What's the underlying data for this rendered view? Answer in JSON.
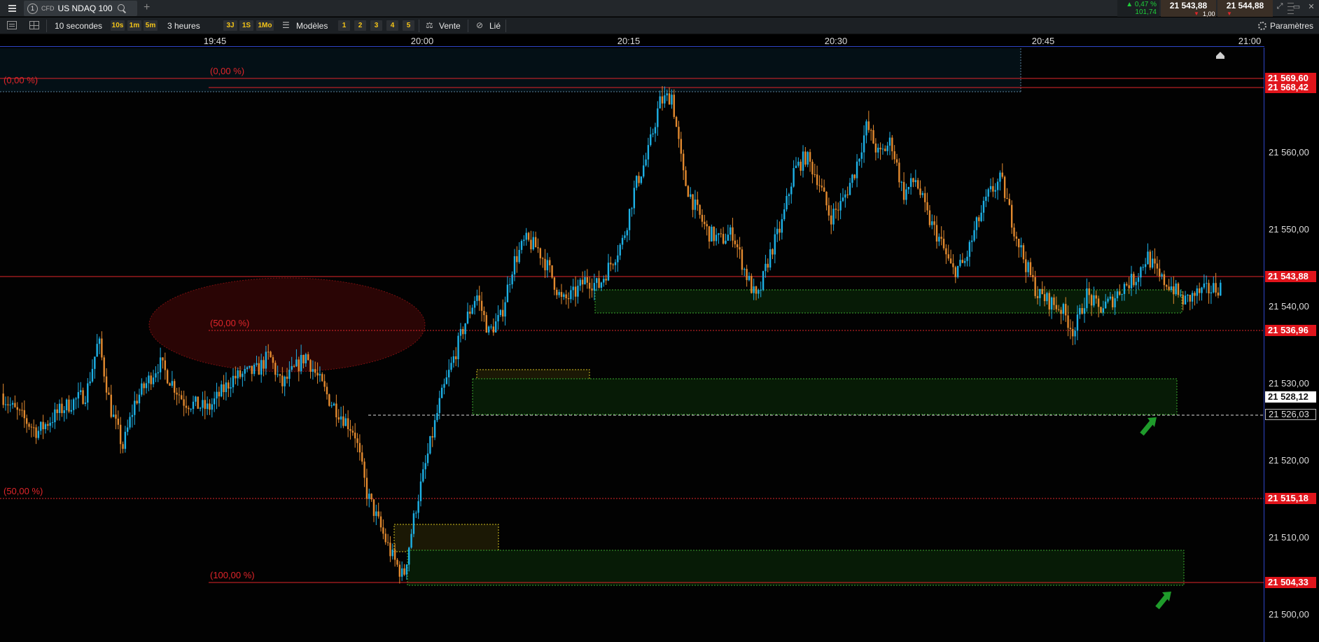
{
  "window": {
    "tab_number": "1",
    "tab_type": "CFD",
    "instrument": "US NDAQ 100",
    "change_pct": "▲ 0,47 %",
    "change_abs": "101,74",
    "bid_price": "21 543,88",
    "ask_price": "21 544,88",
    "spread": "1,00"
  },
  "toolbar": {
    "interval": "10 secondes",
    "interval_buttons": [
      "10s",
      "1m",
      "5m"
    ],
    "period": "3 heures",
    "period_buttons": [
      "3J",
      "1S",
      "1Mo"
    ],
    "models_label": "Modèles",
    "layout_buttons": [
      "1",
      "2",
      "3",
      "4",
      "5"
    ],
    "side_label": "Vente",
    "link_label": "Lié",
    "settings_label": "Paramètres"
  },
  "time_axis": [
    "19:45",
    "20:00",
    "20:15",
    "20:30",
    "20:45",
    "21:00"
  ],
  "price_axis": {
    "ticks": [
      "21 560,00",
      "21 550,00",
      "21 540,00",
      "21 530,00",
      "21 520,00",
      "21 510,00",
      "21 500,00"
    ],
    "tags": {
      "top1": "21 569,60",
      "top2": "21 568,42",
      "current": "21 543,88",
      "fib50_upper": "21 536,96",
      "crosshair": "21 528,12",
      "dashed": "21 526,03",
      "fib50_lower": "21 515,18",
      "bottom": "21 504,33"
    }
  },
  "fib_labels": {
    "upper_0": "(0,00 %)",
    "lower_0": "(0,00 %)",
    "upper_50": "(50,00 %)",
    "lower_50": "(50,00 %)",
    "lower_100": "(100,00 %)"
  },
  "colors": {
    "up_candle": "#1db1e6",
    "down_candle": "#e38a2f",
    "fib_line": "#e0252a",
    "zone_green": "#3ba82d",
    "zone_yellow": "#d6c21e",
    "axis_blue": "#2e46c8",
    "arrow_green": "#1f9b2b"
  },
  "chart_data": {
    "type": "candlestick",
    "instrument": "US NDAQ 100",
    "interval": "10 secondes",
    "time_range": [
      "19:40",
      "21:00"
    ],
    "ylim": [
      21497,
      21570
    ],
    "price_path": [
      [
        0,
        21529
      ],
      [
        0.01,
        21527
      ],
      [
        0.03,
        21524
      ],
      [
        0.05,
        21527
      ],
      [
        0.07,
        21529
      ],
      [
        0.08,
        21536
      ],
      [
        0.09,
        21527
      ],
      [
        0.1,
        21522
      ],
      [
        0.11,
        21528
      ],
      [
        0.13,
        21533
      ],
      [
        0.15,
        21528
      ],
      [
        0.17,
        21527
      ],
      [
        0.19,
        21531
      ],
      [
        0.21,
        21532
      ],
      [
        0.22,
        21534
      ],
      [
        0.23,
        21530
      ],
      [
        0.25,
        21534
      ],
      [
        0.27,
        21528
      ],
      [
        0.29,
        21524
      ],
      [
        0.3,
        21516
      ],
      [
        0.31,
        21512
      ],
      [
        0.32,
        21508
      ],
      [
        0.33,
        21505
      ],
      [
        0.34,
        21514
      ],
      [
        0.35,
        21521
      ],
      [
        0.36,
        21528
      ],
      [
        0.37,
        21533
      ],
      [
        0.38,
        21538
      ],
      [
        0.39,
        21542
      ],
      [
        0.4,
        21537
      ],
      [
        0.41,
        21539
      ],
      [
        0.42,
        21546
      ],
      [
        0.43,
        21549
      ],
      [
        0.44,
        21548
      ],
      [
        0.45,
        21545
      ],
      [
        0.46,
        21541
      ],
      [
        0.47,
        21542
      ],
      [
        0.48,
        21544
      ],
      [
        0.49,
        21543
      ],
      [
        0.5,
        21546
      ],
      [
        0.51,
        21549
      ],
      [
        0.52,
        21556
      ],
      [
        0.53,
        21560
      ],
      [
        0.54,
        21567
      ],
      [
        0.55,
        21568
      ],
      [
        0.56,
        21557
      ],
      [
        0.57,
        21553
      ],
      [
        0.58,
        21550
      ],
      [
        0.59,
        21549
      ],
      [
        0.6,
        21550
      ],
      [
        0.61,
        21545
      ],
      [
        0.62,
        21541
      ],
      [
        0.63,
        21547
      ],
      [
        0.64,
        21551
      ],
      [
        0.65,
        21558
      ],
      [
        0.66,
        21560
      ],
      [
        0.67,
        21557
      ],
      [
        0.68,
        21552
      ],
      [
        0.69,
        21554
      ],
      [
        0.7,
        21558
      ],
      [
        0.71,
        21564
      ],
      [
        0.72,
        21560
      ],
      [
        0.73,
        21562
      ],
      [
        0.74,
        21555
      ],
      [
        0.75,
        21557
      ],
      [
        0.76,
        21552
      ],
      [
        0.77,
        21549
      ],
      [
        0.78,
        21545
      ],
      [
        0.79,
        21546
      ],
      [
        0.8,
        21551
      ],
      [
        0.81,
        21555
      ],
      [
        0.82,
        21557
      ],
      [
        0.83,
        21551
      ],
      [
        0.84,
        21546
      ],
      [
        0.85,
        21542
      ],
      [
        0.86,
        21541
      ],
      [
        0.87,
        21540
      ],
      [
        0.88,
        21537
      ],
      [
        0.89,
        21542
      ],
      [
        0.9,
        21540
      ],
      [
        0.91,
        21541
      ],
      [
        0.92,
        21543
      ],
      [
        0.93,
        21544
      ],
      [
        0.94,
        21547
      ],
      [
        0.95,
        21544
      ],
      [
        0.96,
        21543
      ],
      [
        0.97,
        21541
      ],
      [
        0.98,
        21542
      ],
      [
        1,
        21543
      ]
    ],
    "horizontal_lines": [
      {
        "label": "(0,00 %)",
        "price": 21569.6
      },
      {
        "label": "",
        "price": 21568.42
      },
      {
        "label": "(50,00 %)",
        "price": 21536.96
      },
      {
        "label": "(50,00 %)",
        "price": 21515.18
      },
      {
        "label": "(100,00 %)",
        "price": 21504.33
      },
      {
        "label": "",
        "price": 21543.88
      },
      {
        "label": "",
        "price": 21526.03
      }
    ],
    "zones": [
      {
        "color": "green",
        "price_top": 21542,
        "price_bottom": 21539
      },
      {
        "color": "green",
        "price_top": 21530.7,
        "price_bottom": 21526
      },
      {
        "color": "yellow",
        "price_top": 21531.8,
        "price_bottom": 21530.6
      },
      {
        "color": "yellow",
        "price_top": 21512.7,
        "price_bottom": 21509.2
      },
      {
        "color": "green",
        "price_top": 21509.2,
        "price_bottom": 21504.6
      }
    ]
  }
}
